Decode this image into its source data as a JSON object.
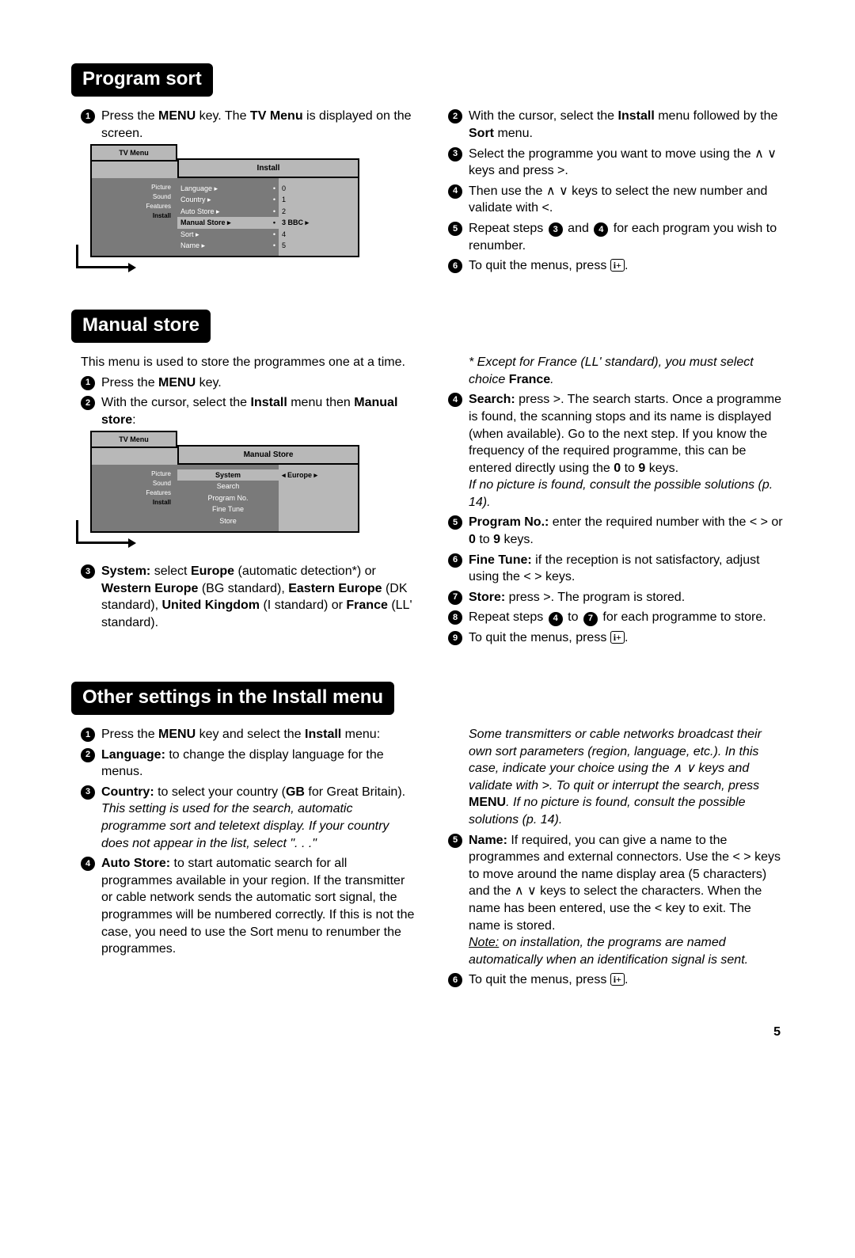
{
  "page_number": "5",
  "sections": {
    "program_sort": {
      "heading": "Program sort",
      "left": {
        "step1_pre": "Press the ",
        "step1_b1": "MENU",
        "step1_mid": " key. The ",
        "step1_b2": "TV Menu",
        "step1_post": " is displayed on the screen."
      },
      "right": {
        "step2_pre": "With the cursor, select the ",
        "step2_b1": "Install",
        "step2_mid": " menu followed by the ",
        "step2_b2": "Sort",
        "step2_post": " menu.",
        "step3": "Select the programme you want to move using the ∧ ∨ keys and press >.",
        "step4": "Then use the ∧ ∨ keys to select the new number and validate with <.",
        "step5_pre": "Repeat steps ",
        "step5_n1": "3",
        "step5_mid": " and ",
        "step5_n2": "4",
        "step5_post": " for each program you wish to renumber.",
        "step6_pre": "To quit the menus, press ",
        "step6_icon": "i+",
        "step6_post": "."
      },
      "diagram": {
        "menu_title": "TV Menu",
        "sub_header": "Install",
        "left_items": [
          "Picture",
          "Sound",
          "Features",
          "Install"
        ],
        "mid_rows": [
          {
            "label": "Language ▸",
            "dot": "•"
          },
          {
            "label": "Country ▸",
            "dot": "•"
          },
          {
            "label": "Auto Store ▸",
            "dot": "•"
          },
          {
            "label": "Manual Store ▸",
            "dot": "•"
          },
          {
            "label": "Sort ▸",
            "dot": "•"
          },
          {
            "label": "Name ▸",
            "dot": "•"
          }
        ],
        "right_rows": [
          "0",
          "1",
          "2",
          "3  BBC   ▸",
          "4",
          "5"
        ]
      }
    },
    "manual_store": {
      "heading": "Manual store",
      "intro": "This menu is used to store the programmes one at a time.",
      "left": {
        "step1_pre": "Press the ",
        "step1_b": "MENU",
        "step1_post": " key.",
        "step2_pre": "With the cursor, select the ",
        "step2_b1": "Install",
        "step2_mid": " menu then ",
        "step2_b2": "Manual store",
        "step2_post": ":",
        "step3_pre": "System:",
        "step3_mid1": " select ",
        "step3_b1": "Europe",
        "step3_mid2": " (automatic detection*) or ",
        "step3_b2": "Western Europe",
        "step3_mid3": " (BG standard), ",
        "step3_b3": "Eastern Europe",
        "step3_mid4": " (DK standard), ",
        "step3_b4": "United Kingdom",
        "step3_mid5": " (I standard) or ",
        "step3_b5": "France",
        "step3_post": " (LL' standard)."
      },
      "right": {
        "footnote_pre": "* Except for France (LL' standard), you must select choice ",
        "footnote_b": "France",
        "footnote_post": ".",
        "step4_label": "Search:",
        "step4_body": " press >. The search starts. Once a programme is found, the scanning stops and its name is displayed (when available). Go to the next step. If you know the frequency of the required programme, this can be entered directly using the ",
        "step4_b1": "0",
        "step4_mid": " to ",
        "step4_b2": "9",
        "step4_post": " keys.",
        "step4_note": "If no picture is found, consult the possible solutions (p. 14).",
        "step5_label": "Program No.:",
        "step5_body": " enter the required number with the < > or ",
        "step5_b1": "0",
        "step5_mid": " to ",
        "step5_b2": "9",
        "step5_post": " keys.",
        "step6_label": "Fine Tune:",
        "step6_body": " if the reception is not satisfactory, adjust using the < > keys.",
        "step7_label": "Store:",
        "step7_body": " press >. The program is stored.",
        "step8_pre": "Repeat steps ",
        "step8_n1": "4",
        "step8_mid": " to ",
        "step8_n2": "7",
        "step8_post": " for each programme to store.",
        "step9_pre": "To quit the menus, press ",
        "step9_icon": "i+",
        "step9_post": "."
      },
      "diagram": {
        "menu_title": "TV Menu",
        "sub_header": "Manual Store",
        "left_items": [
          "Picture",
          "Sound",
          "Features",
          "Install"
        ],
        "mid_rows": [
          "System",
          "Search",
          "Program No.",
          "Fine Tune",
          "Store"
        ],
        "right_val": "◂  Europe  ▸"
      }
    },
    "other_settings": {
      "heading": "Other settings in the Install menu",
      "left": {
        "step1_pre": "Press the ",
        "step1_b1": "MENU",
        "step1_mid": " key and select the ",
        "step1_b2": "Install",
        "step1_post": " menu:",
        "step2_label": "Language:",
        "step2_body": " to change the display language for the menus.",
        "step3_label": "Country:",
        "step3_body": " to select your country (",
        "step3_b": "GB",
        "step3_post": " for Great Britain).",
        "step3_note": "This setting is used for the search, automatic programme sort and teletext display. If your country does not appear in the list, select \". . .\"",
        "step4_label": "Auto Store:",
        "step4_body": " to start automatic search for all programmes available in your region. If the transmitter or cable network sends the automatic sort signal, the programmes will be numbered correctly. If this is not the case, you need to use the Sort menu to renumber the programmes."
      },
      "right": {
        "note1_pre": "Some transmitters or cable networks broadcast their own sort parameters (region, language, etc.). In this case, indicate your choice using the ∧ ∨ keys and validate with >. To quit or interrupt the search, press ",
        "note1_b": "MENU",
        "note1_post": ". If no picture is found, consult the possible solutions (p. 14).",
        "step5_label": "Name:",
        "step5_body": " If required, you can give a name to the programmes and external connectors. Use the < > keys to move around the name display area (5 characters) and the ∧ ∨ keys to select the characters. When the name has been entered, use the < key to exit. The name is stored.",
        "step5_note_label": "Note:",
        "step5_note": " on installation, the programs are named automatically when an identification signal is sent.",
        "step6_pre": "To quit the menus, press ",
        "step6_icon": "i+",
        "step6_post": "."
      }
    }
  }
}
